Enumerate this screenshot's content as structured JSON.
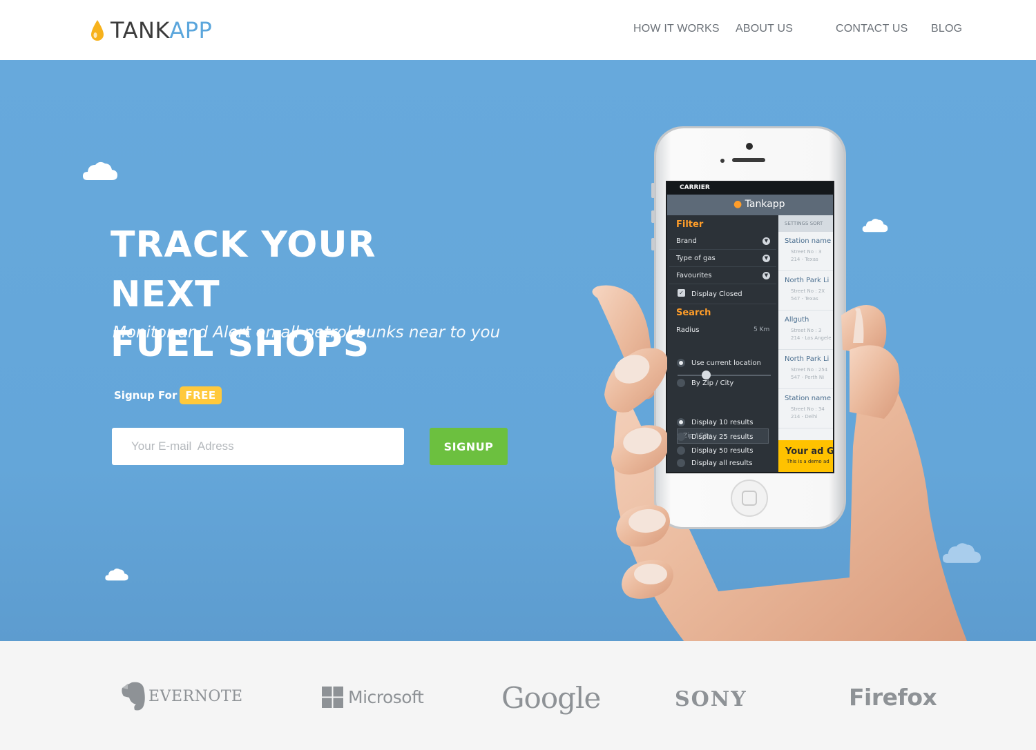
{
  "brand": {
    "name_part1": "TANK",
    "name_part2": "APP"
  },
  "nav": {
    "how": "HOW IT WORKS",
    "about": "ABOUT US",
    "contact": "CONTACT US",
    "blog": "BLOG"
  },
  "hero": {
    "headline_line1": "TRACK YOUR NEXT",
    "headline_line2": "FUEL SHOPS",
    "subline": "Monitor and Alert on all petrol bunks near to you",
    "signup_for": "Signup For",
    "free_badge": "FREE",
    "email_placeholder": "Your E-mail  Adress",
    "signup_button": "SIGNUP"
  },
  "phone": {
    "carrier": "CARRIER",
    "app_title": "Tankapp",
    "filter_title": "Filter",
    "filters": [
      "Brand",
      "Type of gas",
      "Favourites"
    ],
    "display_closed": "Display Closed",
    "search_title": "Search",
    "radius_label": "Radius",
    "radius_value": "5 Km",
    "location_options": [
      "Use current location",
      "By Zip / City"
    ],
    "zip_placeholder": "Zip / City",
    "result_options": [
      "Display 10 results",
      "Display 25 results",
      "Display 50 results",
      "Display all results"
    ],
    "right_header": "SETTINGS   SORT",
    "stations": [
      {
        "name": "Station name",
        "line1": "Street No : 3",
        "line2": "214 - Texas"
      },
      {
        "name": "North Park Li",
        "line1": "Street No : 2X",
        "line2": "547 - Texas"
      },
      {
        "name": "Allguth",
        "line1": "Street No : 3",
        "line2": "214 - Los Angele"
      },
      {
        "name": "North Park Li",
        "line1": "Street No : 254",
        "line2": "547 - Perth Ni"
      },
      {
        "name": "Station name",
        "line1": "Street No : 34",
        "line2": "214 - Delhi"
      }
    ],
    "ad_title": "Your ad Go",
    "ad_sub": "This is a demo ad"
  },
  "partners": {
    "evernote": "EVERNOTE",
    "microsoft": "Microsoft",
    "google": "Google",
    "sony": "SONY",
    "firefox": "Firefox"
  },
  "colors": {
    "hero_bg": "#64a6d9",
    "accent_blue": "#5ba6dc",
    "signup_green": "#6cc03f",
    "free_yellow": "#ffc93c",
    "app_orange": "#ff9d29"
  }
}
